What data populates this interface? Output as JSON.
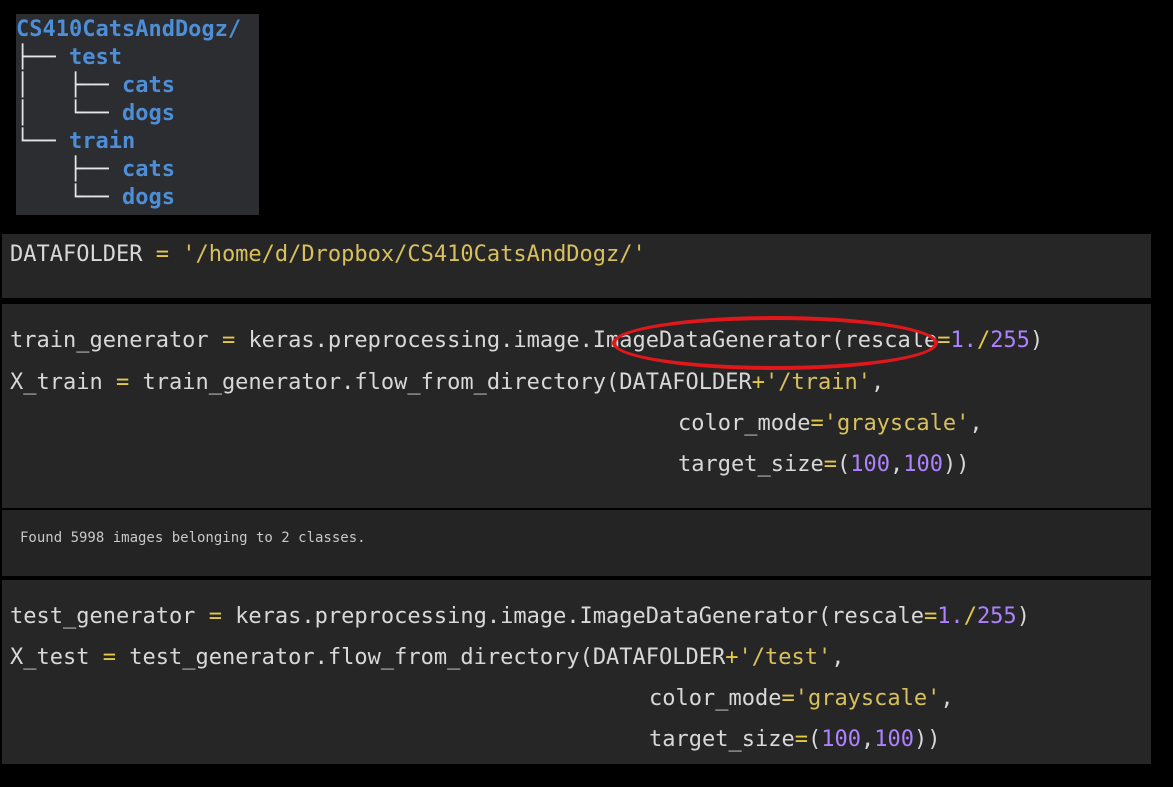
{
  "tree": {
    "root": "CS410CatsAndDogz/",
    "items": [
      {
        "prefix": "├── ",
        "indent": "",
        "label": "test"
      },
      {
        "prefix": "├── ",
        "indent": "│   ",
        "label": "cats"
      },
      {
        "prefix": "└── ",
        "indent": "│   ",
        "label": "dogs"
      },
      {
        "prefix": "└── ",
        "indent": "",
        "label": "train"
      },
      {
        "prefix": "├── ",
        "indent": "    ",
        "label": "cats"
      },
      {
        "prefix": "└── ",
        "indent": "    ",
        "label": "dogs"
      }
    ]
  },
  "cell1": {
    "var": "DATAFOLDER",
    "eq": "=",
    "str": "'/home/d/Dropbox/CS410CatsAndDogz/'"
  },
  "cell2": {
    "line1_a": "train_generator",
    "line1_eq": "=",
    "line1_b": "keras.preprocessing.image.ImageDataGenerator(rescale",
    "line1_op": "=",
    "line1_num1": "1.",
    "line1_div": "/",
    "line1_num2": "255",
    "line1_end": ")",
    "line2_a": "X_train",
    "line2_eq": "=",
    "line2_b": "train_generator.flow_from_directory(DATAFOLDER",
    "line2_plus": "+",
    "line2_str": "'/train'",
    "line2_end": ",",
    "line3_a": "color_mode",
    "line3_eq": "=",
    "line3_str": "'grayscale'",
    "line3_end": ",",
    "line4_a": "target_size",
    "line4_eq": "=",
    "line4_open": "(",
    "line4_n1": "100",
    "line4_comma": ",",
    "line4_n2": "100",
    "line4_end": "))"
  },
  "output": {
    "text": "Found 5998 images belonging to 2 classes."
  },
  "cell3": {
    "line1_a": "test_generator",
    "line1_eq": "=",
    "line1_b": "keras.preprocessing.image.ImageDataGenerator(rescale",
    "line1_op": "=",
    "line1_num1": "1.",
    "line1_div": "/",
    "line1_num2": "255",
    "line1_end": ")",
    "line2_a": "X_test",
    "line2_eq": "=",
    "line2_b": "test_generator.flow_from_directory(DATAFOLDER",
    "line2_plus": "+",
    "line2_str": "'/test'",
    "line2_end": ",",
    "line3_a": "color_mode",
    "line3_eq": "=",
    "line3_str": "'grayscale'",
    "line3_end": ",",
    "line4_a": "target_size",
    "line4_eq": "=",
    "line4_open": "(",
    "line4_n1": "100",
    "line4_comma": ",",
    "line4_n2": "100",
    "line4_end": "))"
  },
  "colors": {
    "string": "#d8c15c",
    "number": "#ae81ff",
    "operator": "#e3c84a",
    "tree_label": "#4d8ed6",
    "highlight": "#e0171b"
  }
}
